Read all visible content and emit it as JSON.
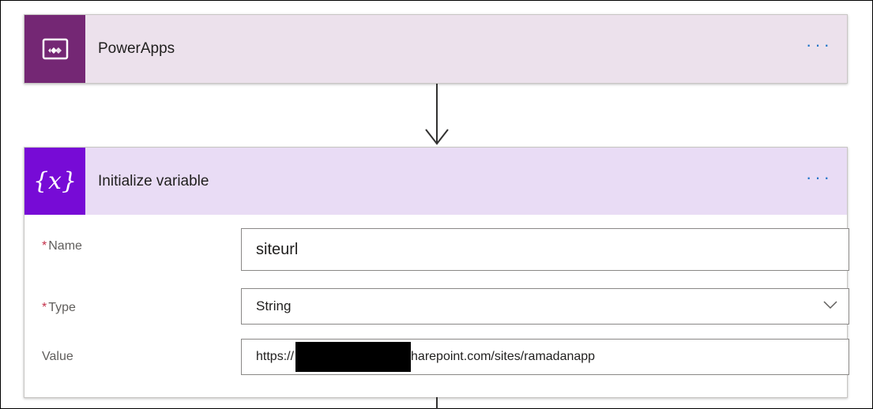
{
  "powerapps_card": {
    "title": "PowerApps",
    "header_bg": "#ece1ec",
    "tile_bg": "#742774",
    "icon": "powerapps-icon",
    "more_label": "···"
  },
  "init_card": {
    "title": "Initialize variable",
    "header_bg": "#e9dcf5",
    "tile_bg": "#770bd6",
    "icon": "variable-icon",
    "icon_text": "{x}",
    "more_label": "···",
    "fields": {
      "name": {
        "required_mark": "*",
        "label": "Name",
        "value": "siteurl"
      },
      "type": {
        "required_mark": "*",
        "label": "Type",
        "value": "String",
        "icon": "chevron-down-icon"
      },
      "value": {
        "label": "Value",
        "value_prefix": "https://",
        "value_suffix": "harepoint.com/sites/ramadanapp"
      }
    }
  }
}
